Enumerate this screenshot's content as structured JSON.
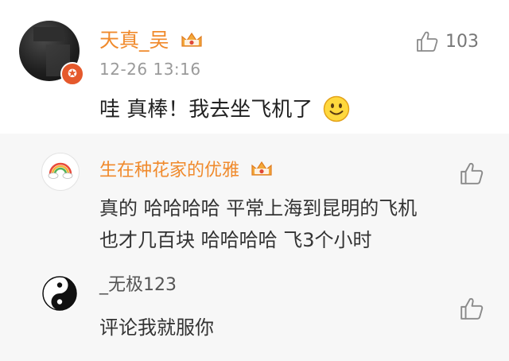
{
  "comment": {
    "username": "天真_吴",
    "time": "12-26 13:16",
    "like_count": "103",
    "text": "哇 真棒！我去坐飞机了",
    "badge_icon": "vip-crown-icon",
    "emoji_icon": "smiley-face-icon"
  },
  "replies": [
    {
      "username": "生在种花家的优雅",
      "lines": [
        "真的 哈哈哈哈 平常上海到昆明的飞机",
        "也才几百块 哈哈哈哈 飞3个小时"
      ],
      "username_color": "#f08a2c"
    },
    {
      "username": "_无极123",
      "lines": [
        "评论我就服你"
      ],
      "username_color": "#555555"
    }
  ],
  "colors": {
    "accent": "#f08a2c",
    "reply_bg": "#f7f7f7",
    "badge": "#e5592c"
  }
}
